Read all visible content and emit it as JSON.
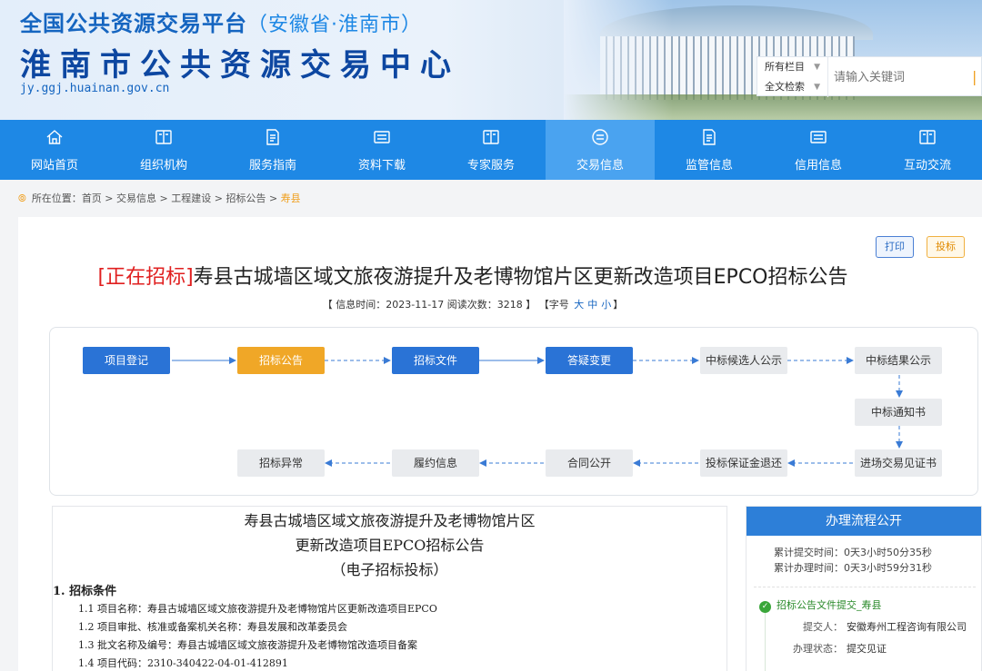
{
  "header": {
    "platform_title": "全国公共资源交易平台",
    "platform_region": "（安徽省·淮南市）",
    "center_title": "淮南市公共资源交易中心",
    "domain": "jy.ggj.huainan.gov.cn"
  },
  "search": {
    "scope_column": "所有栏目",
    "scope_mode": "全文检索",
    "placeholder": "请输入关键词"
  },
  "nav": {
    "items": [
      {
        "label": "网站首页",
        "icon": "home-icon"
      },
      {
        "label": "组织机构",
        "icon": "book-icon"
      },
      {
        "label": "服务指南",
        "icon": "document-icon"
      },
      {
        "label": "资料下载",
        "icon": "list-icon"
      },
      {
        "label": "专家服务",
        "icon": "book-icon"
      },
      {
        "label": "交易信息",
        "icon": "circle-lines-icon",
        "active": true
      },
      {
        "label": "监管信息",
        "icon": "document-icon"
      },
      {
        "label": "信用信息",
        "icon": "list-icon"
      },
      {
        "label": "互动交流",
        "icon": "book-icon"
      }
    ]
  },
  "breadcrumb": {
    "prefix": "所在位置：",
    "path": "首页 > 交易信息 > 工程建设 > 招标公告 > ",
    "current": "寿县"
  },
  "actions": {
    "print": "打印",
    "bid": "投标"
  },
  "announcement": {
    "tag": "[正在招标]",
    "title": "寿县古城墙区域文旅夜游提升及老博物馆片区更新改造项目EPCO招标公告",
    "meta_left": "【 信息时间：2023-11-17 阅读次数：3218 】 【字号",
    "size_large": "大",
    "size_medium": "中",
    "size_small": "小",
    "meta_right": "】"
  },
  "flow": {
    "nodes": [
      {
        "key": "n1",
        "label": "项目登记",
        "state": "done"
      },
      {
        "key": "n2",
        "label": "招标公告",
        "state": "current"
      },
      {
        "key": "n3",
        "label": "招标文件",
        "state": "done"
      },
      {
        "key": "n4",
        "label": "答疑变更",
        "state": "done"
      },
      {
        "key": "n5",
        "label": "中标候选人公示",
        "state": "todo"
      },
      {
        "key": "n6",
        "label": "中标结果公示",
        "state": "todo"
      },
      {
        "key": "n7",
        "label": "中标通知书",
        "state": "todo"
      },
      {
        "key": "n8",
        "label": "进场交易见证书",
        "state": "todo"
      },
      {
        "key": "n9",
        "label": "投标保证金退还",
        "state": "todo"
      },
      {
        "key": "n10",
        "label": "合同公开",
        "state": "todo"
      },
      {
        "key": "n11",
        "label": "履约信息",
        "state": "todo"
      },
      {
        "key": "n12",
        "label": "招标异常",
        "state": "todo"
      }
    ],
    "colors": {
      "done": "#2a73d6",
      "current": "#f0a727",
      "todo": "#e9ebee",
      "arrow": "#3a7bd5"
    }
  },
  "document": {
    "heading_line1": "寿县古城墙区域文旅夜游提升及老博物馆片区",
    "heading_line2": "更新改造项目EPCO招标公告",
    "heading_line3": "（电子招标投标）",
    "section1": "1.  招标条件",
    "lines": [
      "1.1 项目名称：寿县古城墙区域文旅夜游提升及老博物馆片区更新改造项目EPCO",
      "1.2 项目审批、核准或备案机关名称：寿县发展和改革委员会",
      "1.3 批文名称及编号：寿县古城墙区域文旅夜游提升及老博物馆改造项目备案",
      "1.4 项目代码：2310-340422-04-01-412891"
    ]
  },
  "sidebar": {
    "title": "办理流程公开",
    "total_submit": "累计提交时间：0天3小时50分35秒",
    "total_process": "累计办理时间：0天3小时59分31秒",
    "step_label": "招标公告文件提交_寿县",
    "submitter_key": "提交人：",
    "submitter_val": "安徽寿州工程咨询有限公司",
    "status_key": "办理状态：",
    "status_val": "提交见证"
  }
}
